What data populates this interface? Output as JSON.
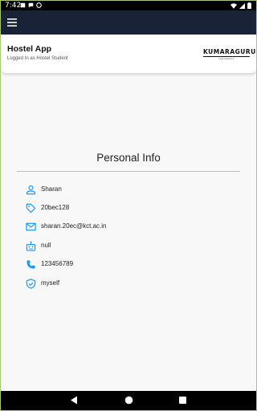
{
  "status_bar": {
    "time": "7:42"
  },
  "app_bar": {
    "menu_icon": "hamburger-menu-icon"
  },
  "header": {
    "title": "Hostel App",
    "subtitle": "Logged In as Hostel Student",
    "logo_text": "KUMARAGURU",
    "logo_subtext": "institutions"
  },
  "page": {
    "title": "Personal Info"
  },
  "info": [
    {
      "icon": "person-icon",
      "value": "Sharan"
    },
    {
      "icon": "tag-icon",
      "value": "20bec128"
    },
    {
      "icon": "mail-icon",
      "value": "sharan.20ec@kct.ac.in"
    },
    {
      "icon": "robot-icon",
      "value": "null"
    },
    {
      "icon": "phone-icon",
      "value": "123456789"
    },
    {
      "icon": "shield-icon",
      "value": "myself"
    }
  ],
  "colors": {
    "app_bar": "#1a2238",
    "accent": "#2196f3",
    "background": "#f8f8f8",
    "outer_border": "#a9c873"
  }
}
